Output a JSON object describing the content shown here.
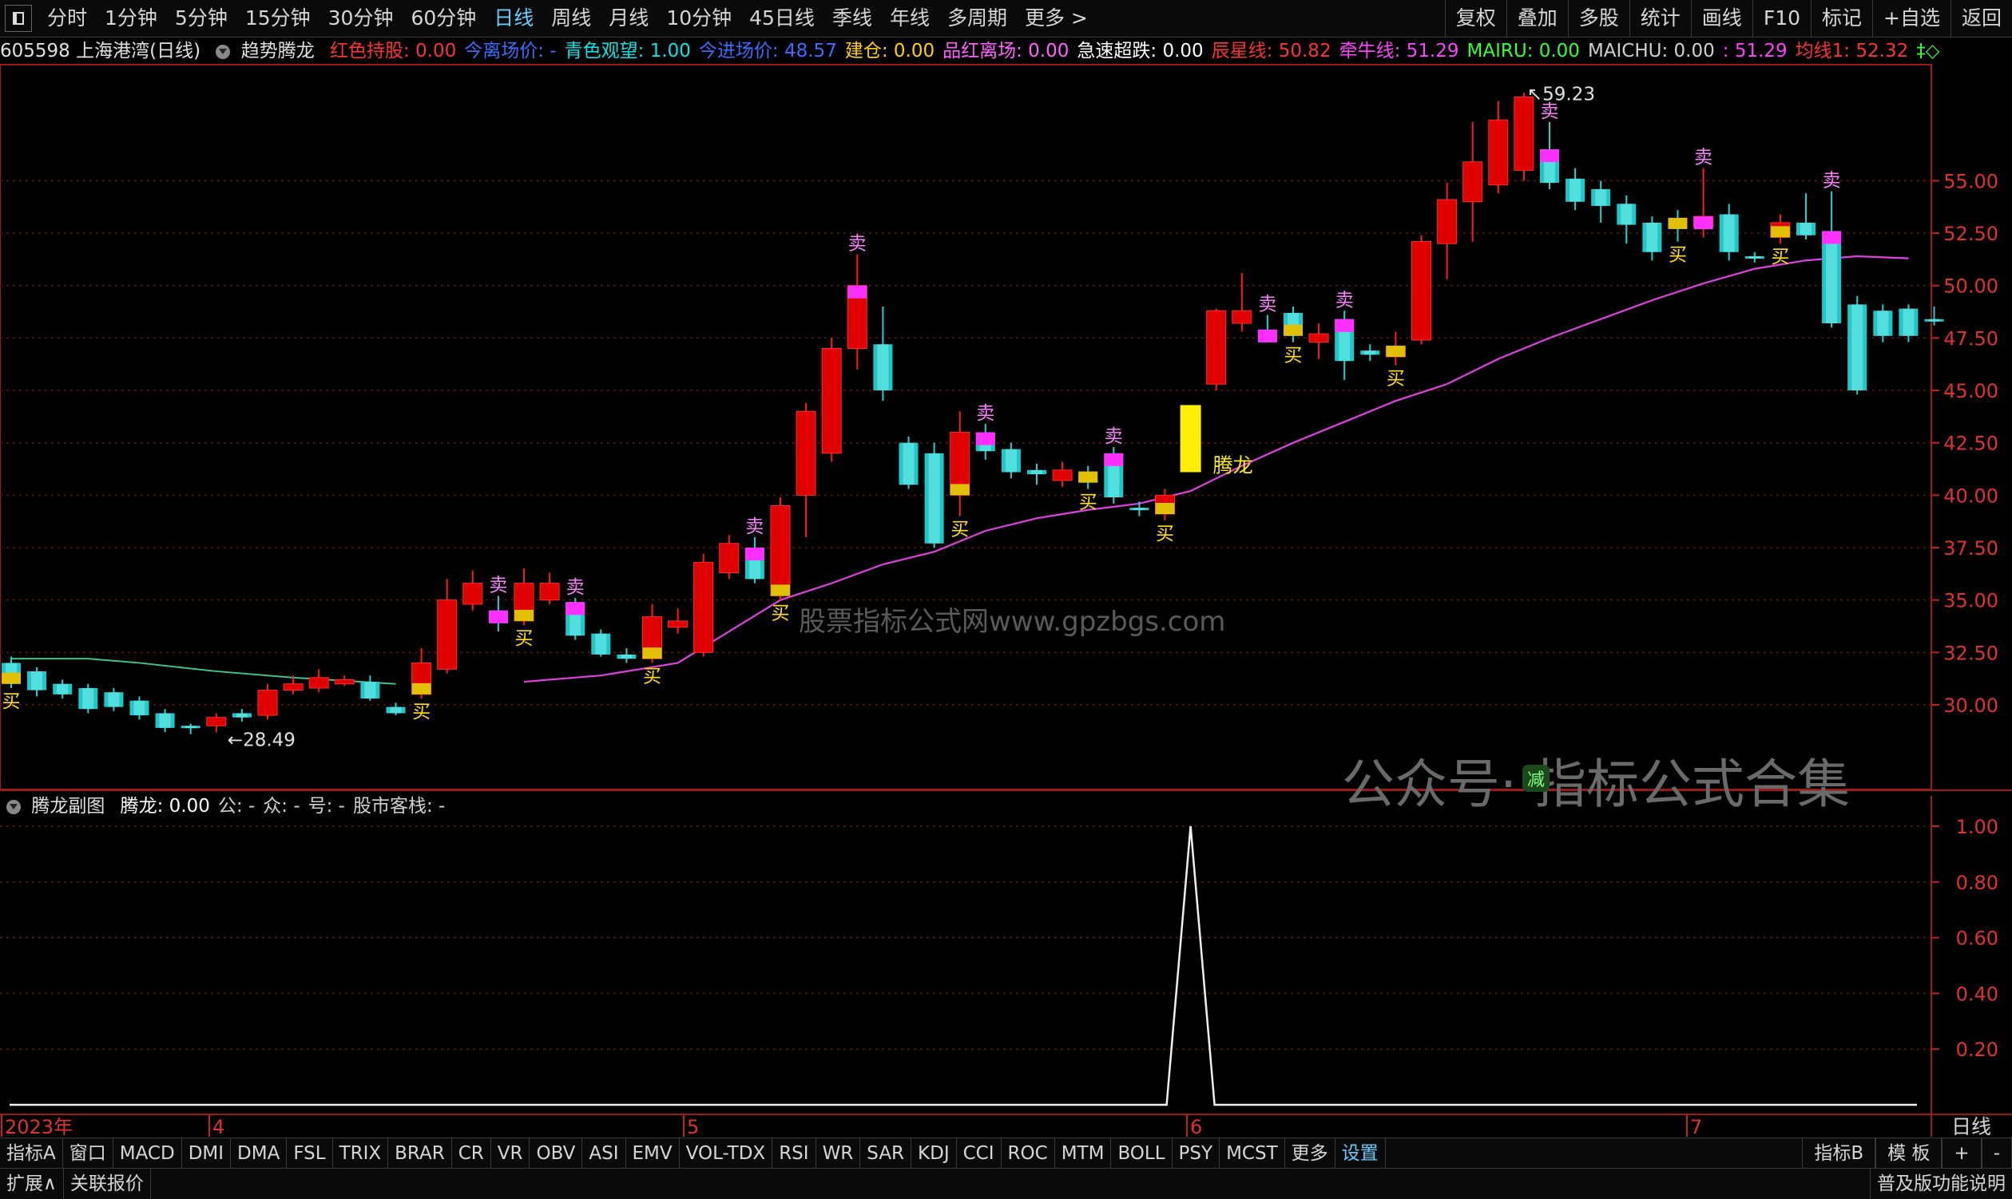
{
  "toolbar": {
    "periods": [
      "分时",
      "1分钟",
      "5分钟",
      "15分钟",
      "30分钟",
      "60分钟",
      "日线",
      "周线",
      "月线",
      "10分钟",
      "45日线",
      "季线",
      "年线",
      "多周期",
      "更多 >"
    ],
    "right_buttons": [
      "复权",
      "叠加",
      "多股",
      "统计",
      "画线",
      "F10",
      "标记",
      "+自选",
      "返回"
    ]
  },
  "info": {
    "stock": "605598 上海港湾(日线)",
    "indicator": "趋势腾龙",
    "items": [
      {
        "label": "红色持股: 0.00",
        "color": "#ff3030"
      },
      {
        "label": "今离场价: -",
        "color": "#3a6cff"
      },
      {
        "label": "青色观望: 1.00",
        "color": "#00e5e5"
      },
      {
        "label": "今进场价: 48.57",
        "color": "#3a6cff"
      },
      {
        "label": "建仓: 0.00",
        "color": "#ffd000"
      },
      {
        "label": "品红离场: 0.00",
        "color": "#ff60ff"
      },
      {
        "label": "急速超跌: 0.00",
        "color": "#ffffff"
      },
      {
        "label": "辰星线: 50.82",
        "color": "#ff3030"
      },
      {
        "label": "牵牛线: 51.29",
        "color": "#ff40ff"
      },
      {
        "label": "MAIRU: 0.00",
        "color": "#30ff30"
      },
      {
        "label": "MAICHU: 0.00",
        "color": "#d0d0d0"
      },
      {
        "label": ": 51.29",
        "color": "#ff40ff"
      },
      {
        "label": "均线1: 52.32",
        "color": "#ff3030"
      },
      {
        "label": "‡◇",
        "color": "#30ff30"
      }
    ]
  },
  "sub": {
    "title": "腾龙副图",
    "items": [
      {
        "label": "腾龙: 0.00",
        "color": "#ffffff"
      },
      {
        "label": "公: -",
        "color": "#d0d0d0"
      },
      {
        "label": "众: -",
        "color": "#d0d0d0"
      },
      {
        "label": "号: -",
        "color": "#d0d0d0"
      },
      {
        "label": "股市客栈: -",
        "color": "#d0d0d0"
      }
    ]
  },
  "chart_data": {
    "type": "candlestick",
    "price_axis": [
      55.0,
      52.5,
      50.0,
      47.5,
      45.0,
      42.5,
      40.0,
      37.5,
      35.0,
      32.5,
      30.0
    ],
    "sub_axis": [
      1.0,
      0.8,
      0.6,
      0.4,
      0.2
    ],
    "ylim": [
      26.0,
      60.5
    ],
    "sub_ylim": [
      0,
      1.0
    ],
    "high_label": "59.23",
    "low_label": "28.49",
    "month_labels": [
      "2023年",
      "4",
      "5",
      "6",
      "7"
    ],
    "candles": [
      [
        32.0,
        31.0,
        32.3,
        30.8,
        "c"
      ],
      [
        31.6,
        30.7,
        31.8,
        30.4,
        "c"
      ],
      [
        31.0,
        30.5,
        31.2,
        30.3,
        "c"
      ],
      [
        30.8,
        29.8,
        31.0,
        29.6,
        "c"
      ],
      [
        30.6,
        29.9,
        30.8,
        29.7,
        "c"
      ],
      [
        30.2,
        29.5,
        30.4,
        29.3,
        "c"
      ],
      [
        29.6,
        28.9,
        29.8,
        28.7,
        "c"
      ],
      [
        29.0,
        28.9,
        29.1,
        28.6,
        "c"
      ],
      [
        29.0,
        29.4,
        29.6,
        28.7,
        "r"
      ],
      [
        29.4,
        29.6,
        29.8,
        29.2,
        "c"
      ],
      [
        29.5,
        30.7,
        31.0,
        29.3,
        "r"
      ],
      [
        30.7,
        31.0,
        31.4,
        30.5,
        "r"
      ],
      [
        30.8,
        31.3,
        31.7,
        30.6,
        "r"
      ],
      [
        31.0,
        31.2,
        31.4,
        30.9,
        "r"
      ],
      [
        31.1,
        30.3,
        31.4,
        30.2,
        "c"
      ],
      [
        29.9,
        29.6,
        30.1,
        29.5,
        "c"
      ],
      [
        30.5,
        32.0,
        32.7,
        30.3,
        "r"
      ],
      [
        31.7,
        35.0,
        36.0,
        31.5,
        "r"
      ],
      [
        34.8,
        35.8,
        36.4,
        34.5,
        "r"
      ],
      [
        34.5,
        33.9,
        35.2,
        33.5,
        "c"
      ],
      [
        34.0,
        35.8,
        36.5,
        33.8,
        "r"
      ],
      [
        35.8,
        35.0,
        36.3,
        34.8,
        "r"
      ],
      [
        34.9,
        33.3,
        35.1,
        33.1,
        "c"
      ],
      [
        33.4,
        32.4,
        33.6,
        32.3,
        "c"
      ],
      [
        32.4,
        32.2,
        32.7,
        32.0,
        "c"
      ],
      [
        32.2,
        34.2,
        34.8,
        32.0,
        "r"
      ],
      [
        33.7,
        34.0,
        34.6,
        33.4,
        "r"
      ],
      [
        32.5,
        36.8,
        37.2,
        32.3,
        "r"
      ],
      [
        36.3,
        37.7,
        38.1,
        36.0,
        "r"
      ],
      [
        37.5,
        36.0,
        38.0,
        35.8,
        "c"
      ],
      [
        35.2,
        39.5,
        39.9,
        35.0,
        "r"
      ],
      [
        40.0,
        44.0,
        44.4,
        38.0,
        "r"
      ],
      [
        42.0,
        47.0,
        47.5,
        41.6,
        "r"
      ],
      [
        47.0,
        50.0,
        51.5,
        46.0,
        "r"
      ],
      [
        47.2,
        45.0,
        49.0,
        44.5,
        "c"
      ],
      [
        42.5,
        40.5,
        42.8,
        40.3,
        "c"
      ],
      [
        42.0,
        37.7,
        42.5,
        37.5,
        "c"
      ],
      [
        40.0,
        43.0,
        44.0,
        39.0,
        "r"
      ],
      [
        43.0,
        42.1,
        43.4,
        41.7,
        "c"
      ],
      [
        42.2,
        41.1,
        42.5,
        40.8,
        "c"
      ],
      [
        41.2,
        41.0,
        41.5,
        40.5,
        "c"
      ],
      [
        40.7,
        41.2,
        41.6,
        40.4,
        "r"
      ],
      [
        41.0,
        40.6,
        41.4,
        40.3,
        "c"
      ],
      [
        42.0,
        39.9,
        42.3,
        39.6,
        "c"
      ],
      [
        39.4,
        39.3,
        39.7,
        39.0,
        "c"
      ],
      [
        39.1,
        40.0,
        40.3,
        38.8,
        "r"
      ],
      [
        41.1,
        44.3,
        44.3,
        41.1,
        "y"
      ],
      [
        45.3,
        48.8,
        48.9,
        45.0,
        "r"
      ],
      [
        48.8,
        48.2,
        50.6,
        47.8,
        "r"
      ],
      [
        47.6,
        47.9,
        48.6,
        47.4,
        "c"
      ],
      [
        48.7,
        47.6,
        49.0,
        47.3,
        "c"
      ],
      [
        47.3,
        47.7,
        48.2,
        46.5,
        "r"
      ],
      [
        48.4,
        46.4,
        48.8,
        45.5,
        "c"
      ],
      [
        46.7,
        46.9,
        47.2,
        46.4,
        "c"
      ],
      [
        46.6,
        47.1,
        47.8,
        46.2,
        "r"
      ],
      [
        47.4,
        52.1,
        52.4,
        47.2,
        "r"
      ],
      [
        52.0,
        54.1,
        54.9,
        50.3,
        "r"
      ],
      [
        54.0,
        55.9,
        57.8,
        52.1,
        "r"
      ],
      [
        54.8,
        57.9,
        58.8,
        54.4,
        "r"
      ],
      [
        55.5,
        59.0,
        59.2,
        55.0,
        "r"
      ],
      [
        56.5,
        54.9,
        57.8,
        54.6,
        "c"
      ],
      [
        55.1,
        54.0,
        55.6,
        53.6,
        "c"
      ],
      [
        54.6,
        53.8,
        55.0,
        53.0,
        "c"
      ],
      [
        53.9,
        52.9,
        54.3,
        52.0,
        "c"
      ],
      [
        53.0,
        51.6,
        53.3,
        51.2,
        "c"
      ],
      [
        52.9,
        52.7,
        53.6,
        52.1,
        "c"
      ],
      [
        52.8,
        53.3,
        55.6,
        52.3,
        "r"
      ],
      [
        53.4,
        51.6,
        53.9,
        51.2,
        "c"
      ],
      [
        51.4,
        51.3,
        51.6,
        51.1,
        "c"
      ],
      [
        52.3,
        53.0,
        53.4,
        52.0,
        "r"
      ],
      [
        53.0,
        52.4,
        54.4,
        52.2,
        "c"
      ],
      [
        52.6,
        48.2,
        54.5,
        48.0,
        "c"
      ],
      [
        49.1,
        45.0,
        49.5,
        44.8,
        "c"
      ],
      [
        48.8,
        47.6,
        49.1,
        47.3,
        "c"
      ],
      [
        48.9,
        47.6,
        49.1,
        47.3,
        "c"
      ],
      [
        48.4,
        48.3,
        49.0,
        48.1,
        "c"
      ]
    ],
    "ma_line": [
      [
        20,
        31.1
      ],
      [
        23,
        31.4
      ],
      [
        26,
        32.0
      ],
      [
        28,
        33.5
      ],
      [
        30,
        35.0
      ],
      [
        32,
        35.8
      ],
      [
        34,
        36.7
      ],
      [
        36,
        37.3
      ],
      [
        38,
        38.3
      ],
      [
        40,
        38.9
      ],
      [
        42,
        39.3
      ],
      [
        44,
        39.6
      ],
      [
        46,
        40.2
      ],
      [
        48,
        41.4
      ],
      [
        50,
        42.5
      ],
      [
        52,
        43.5
      ],
      [
        54,
        44.5
      ],
      [
        56,
        45.3
      ],
      [
        58,
        46.5
      ],
      [
        60,
        47.5
      ],
      [
        62,
        48.4
      ],
      [
        64,
        49.3
      ],
      [
        66,
        50.1
      ],
      [
        68,
        50.8
      ],
      [
        70,
        51.2
      ],
      [
        72,
        51.4
      ],
      [
        74,
        51.3
      ]
    ],
    "early_line": [
      [
        0,
        32.2
      ],
      [
        3,
        32.2
      ],
      [
        5,
        32.0
      ],
      [
        8,
        31.6
      ],
      [
        11,
        31.3
      ],
      [
        15,
        31.0
      ]
    ],
    "markers": [
      {
        "i": 0,
        "t": "买"
      },
      {
        "i": 16,
        "t": "买"
      },
      {
        "i": 19,
        "t": "卖"
      },
      {
        "i": 20,
        "t": "买"
      },
      {
        "i": 22,
        "t": "卖"
      },
      {
        "i": 25,
        "t": "买"
      },
      {
        "i": 29,
        "t": "卖"
      },
      {
        "i": 30,
        "t": "买"
      },
      {
        "i": 33,
        "t": "卖"
      },
      {
        "i": 37,
        "t": "买"
      },
      {
        "i": 38,
        "t": "卖"
      },
      {
        "i": 42,
        "t": "买"
      },
      {
        "i": 43,
        "t": "卖"
      },
      {
        "i": 45,
        "t": "买"
      },
      {
        "i": 49,
        "t": "卖"
      },
      {
        "i": 50,
        "t": "买"
      },
      {
        "i": 52,
        "t": "卖"
      },
      {
        "i": 54,
        "t": "买"
      },
      {
        "i": 60,
        "t": "卖"
      },
      {
        "i": 65,
        "t": "买"
      },
      {
        "i": 66,
        "t": "卖"
      },
      {
        "i": 69,
        "t": "买"
      },
      {
        "i": 71,
        "t": "卖"
      }
    ],
    "tenglong_label": "腾龙",
    "tenglong_index": 46,
    "sub_series": {
      "peak_index": 46,
      "peak_value": 1.0
    }
  },
  "watermarks": {
    "center": "股票指标公式网www.gpzbgs.com",
    "right": "公众号· 指标公式合集",
    "badge": "减"
  },
  "bottom": {
    "tabs": [
      "指标A",
      "窗口",
      "MACD",
      "DMI",
      "DMA",
      "FSL",
      "TRIX",
      "BRAR",
      "CR",
      "VR",
      "OBV",
      "ASI",
      "EMV",
      "VOL-TDX",
      "RSI",
      "WR",
      "SAR",
      "KDJ",
      "CCI",
      "ROC",
      "MTM",
      "BOLL",
      "PSY",
      "MCST",
      "更多",
      "设置"
    ],
    "right": [
      "指标B",
      "模 板",
      "+",
      "-"
    ],
    "period_right": "日线"
  },
  "status": {
    "left": [
      "扩展∧",
      "关联报价"
    ],
    "right": "普及版功能说明"
  }
}
